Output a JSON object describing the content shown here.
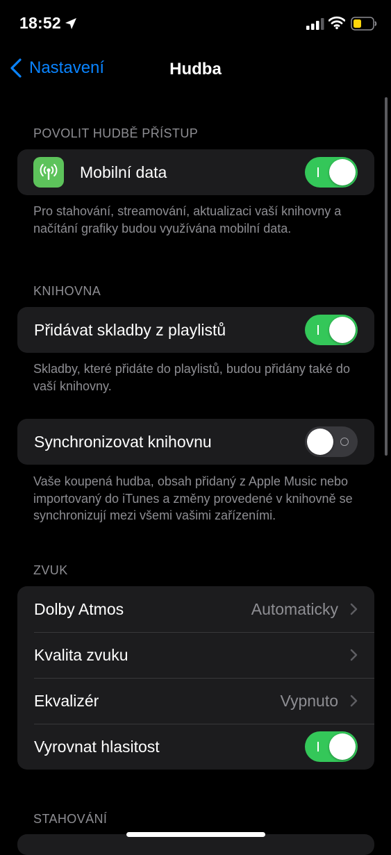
{
  "status_bar": {
    "time": "18:52"
  },
  "nav": {
    "back_label": "Nastavení",
    "title": "Hudba"
  },
  "sections": {
    "access": {
      "header": "POVOLIT HUDBĚ PŘÍSTUP",
      "mobile_data_label": "Mobilní data",
      "mobile_data_on": true,
      "footer": "Pro stahování, streamování, aktualizaci vaší knihovny a načítání grafiky budou využívána mobilní data."
    },
    "library": {
      "header": "KNIHOVNA",
      "add_songs_label": "Přidávat skladby z playlistů",
      "add_songs_on": true,
      "add_songs_footer": "Skladby, které přidáte do playlistů, budou přidány také do vaší knihovny.",
      "sync_label": "Synchronizovat knihovnu",
      "sync_on": false,
      "sync_footer": "Vaše koupená hudba, obsah přidaný z Apple Music nebo importovaný do iTunes a změny provedené v knihovně se synchronizují mezi všemi vašimi zařízeními."
    },
    "sound": {
      "header": "ZVUK",
      "rows": [
        {
          "label": "Dolby Atmos",
          "value": "Automaticky"
        },
        {
          "label": "Kvalita zvuku",
          "value": ""
        },
        {
          "label": "Ekvalizér",
          "value": "Vypnuto"
        },
        {
          "label": "Vyrovnat hlasitost",
          "toggle_on": true
        }
      ]
    },
    "downloads": {
      "header": "STAHOVÁNÍ"
    }
  },
  "colors": {
    "accent": "#0a84ff",
    "toggle_on": "#34c759",
    "cell_bg": "#1c1c1e",
    "secondary_text": "#8e8e93"
  }
}
